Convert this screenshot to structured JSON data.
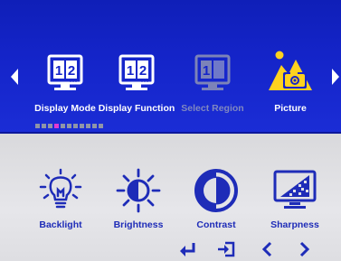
{
  "menu": {
    "items": [
      {
        "label": "Display Mode",
        "icon": "monitor-1-2-icon",
        "state": "normal"
      },
      {
        "label": "Display Function",
        "icon": "monitor-1-2-icon",
        "state": "normal"
      },
      {
        "label": "Select Region",
        "icon": "monitor-select-region-icon",
        "state": "disabled"
      },
      {
        "label": "Picture",
        "icon": "picture-camera-icon",
        "state": "selected"
      }
    ],
    "page_indicator": {
      "count": 11,
      "active_index": 3
    }
  },
  "submenu": {
    "items": [
      {
        "label": "Backlight",
        "icon": "lightbulb-icon"
      },
      {
        "label": "Brightness",
        "icon": "sun-icon"
      },
      {
        "label": "Contrast",
        "icon": "contrast-icon"
      },
      {
        "label": "Sharpness",
        "icon": "sharpness-icon"
      }
    ]
  },
  "nav_keys": [
    {
      "icon": "enter-icon"
    },
    {
      "icon": "exit-icon"
    },
    {
      "icon": "chevron-left-icon"
    },
    {
      "icon": "chevron-right-icon"
    }
  ],
  "colors": {
    "top_panel": "#1424c8",
    "selected_icon": "#ffd21f",
    "submenu_label": "#1e2cb8",
    "page_dot_active": "#e23ad0"
  }
}
